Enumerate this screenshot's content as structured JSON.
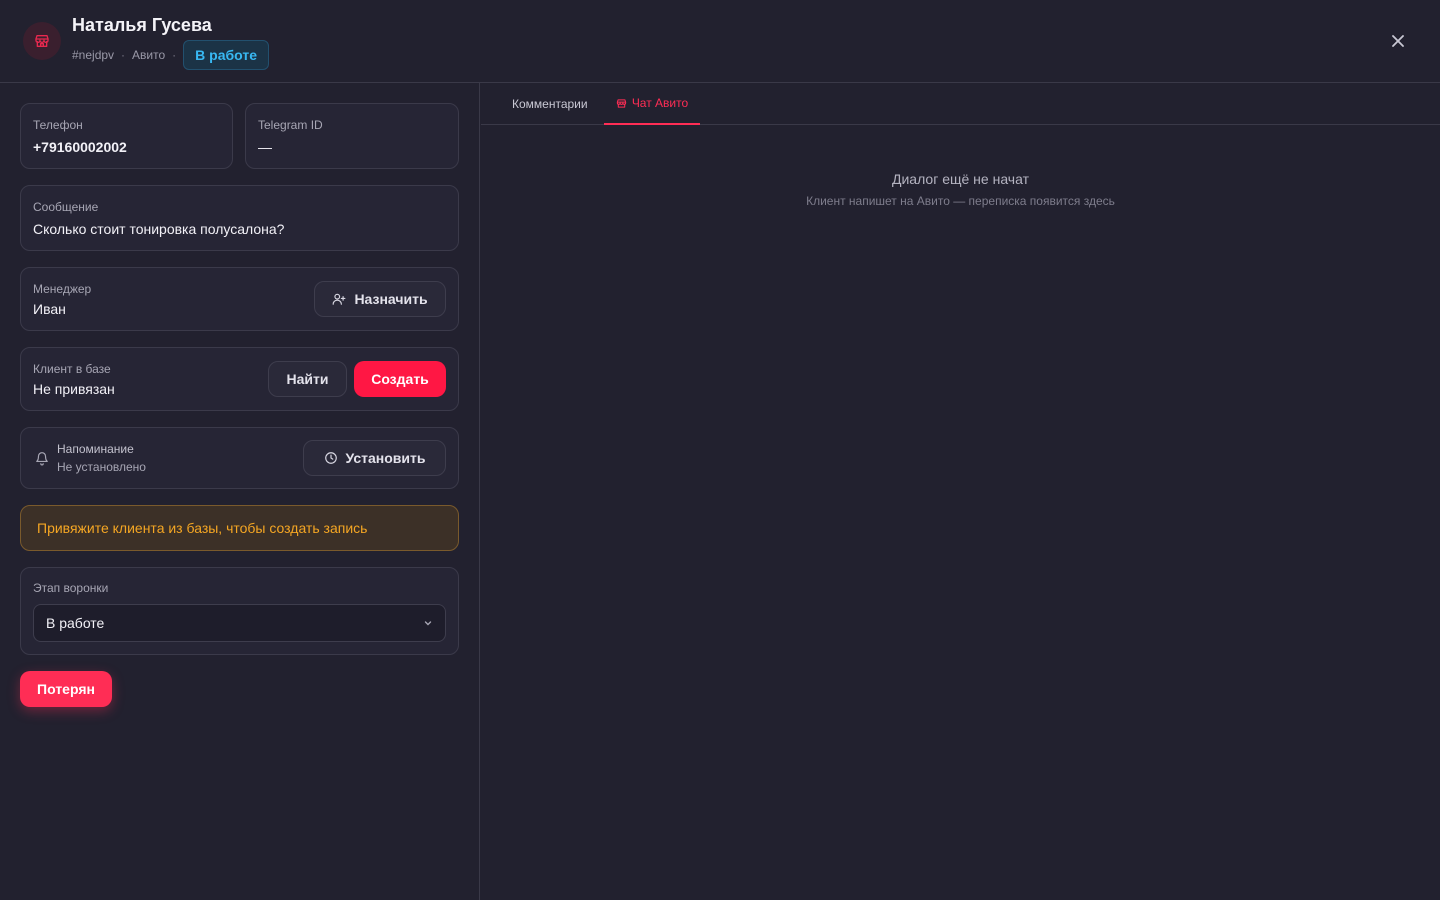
{
  "header": {
    "title": "Наталья Гусева",
    "lead_id": "#nejdpv",
    "separator": "·",
    "source": "Авито",
    "status": "В работе",
    "store_icon": "store-icon",
    "close_icon": "close-icon"
  },
  "fields": {
    "phone": {
      "label": "Телефон",
      "value": "+79160002002"
    },
    "telegram": {
      "label": "Telegram ID",
      "value": "—"
    },
    "message": {
      "label": "Сообщение",
      "value": "Сколько стоит тонировка полусалона?"
    },
    "manager": {
      "label": "Менеджер",
      "value": "Иван",
      "assign_label": "Назначить"
    },
    "client": {
      "label": "Клиент в базе",
      "value": "Не привязан",
      "find_label": "Найти",
      "create_label": "Создать"
    },
    "reminder": {
      "label": "Напоминание",
      "value": "Не установлено",
      "set_label": "Установить"
    }
  },
  "warning": "Привяжите клиента из базы, чтобы создать запись",
  "funnel": {
    "label": "Этап воронки",
    "selected": "В работе"
  },
  "lost_label": "Потерян",
  "tabs": [
    {
      "label": "Комментарии",
      "active": false
    },
    {
      "label": "Чат Авито",
      "active": true
    }
  ],
  "chat": {
    "empty_title": "Диалог ещё не начат",
    "empty_sub": "Клиент напишет на Авито — переписка появится здесь"
  },
  "colors": {
    "background": "#22212f",
    "accent": "#ff1744",
    "status_blue": "#38b8f2",
    "warning": "#f5a623"
  }
}
